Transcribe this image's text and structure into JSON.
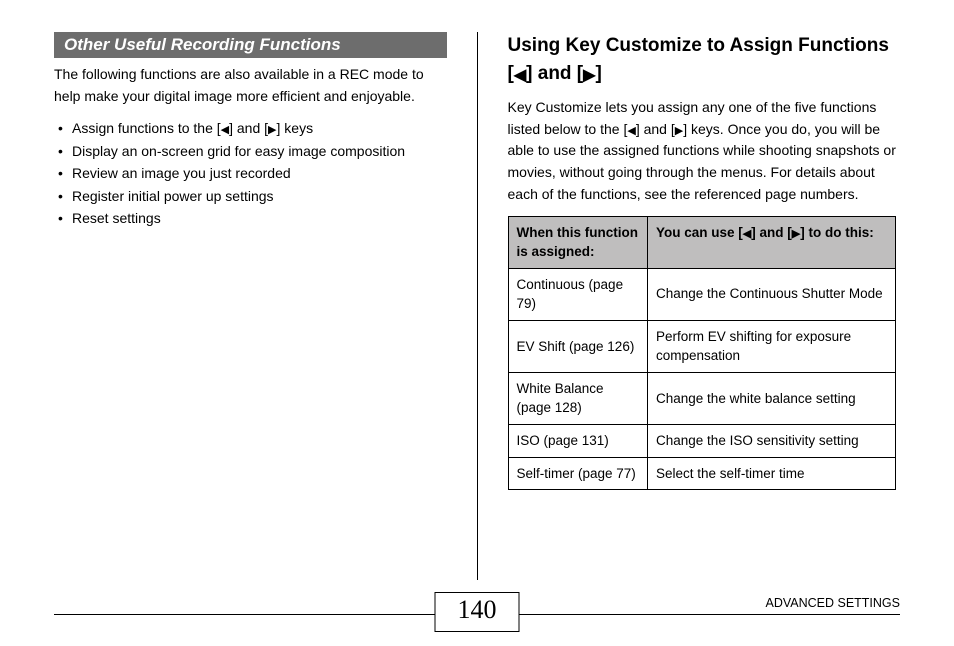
{
  "left": {
    "banner": "Other Useful Recording Functions",
    "intro": "The following functions are also available in a REC mode to help make your digital image more efficient and enjoyable.",
    "bullets": {
      "b0a": "Assign functions to the [",
      "b0b": "] and [",
      "b0c": "] keys",
      "b1": "Display an on-screen grid for easy image composition",
      "b2": "Review an image you just recorded",
      "b3": "Register initial power up settings",
      "b4": "Reset settings"
    }
  },
  "right": {
    "heading_a": "Using Key Customize to Assign Functions [",
    "heading_b": "] and [",
    "heading_c": "]",
    "intro_a": "Key Customize lets you assign any one of the five functions listed below to the [",
    "intro_b": "] and [",
    "intro_c": "] keys. Once you do, you will be able to use the assigned functions while shooting snapshots or movies, without going through the menus. For details about each of the functions, see the referenced page numbers.",
    "table": {
      "th1": "When this function is assigned:",
      "th2a": "You can use [",
      "th2b": "] and [",
      "th2c": "] to do this:",
      "rows": [
        {
          "a": "Continuous (page 79)",
          "b": "Change the Continuous Shutter Mode"
        },
        {
          "a": "EV Shift (page 126)",
          "b": "Perform EV shifting for exposure compensation"
        },
        {
          "a": "White Balance (page 128)",
          "b": "Change the white balance setting"
        },
        {
          "a": "ISO (page 131)",
          "b": "Change the ISO sensitivity setting"
        },
        {
          "a": "Self-timer (page 77)",
          "b": "Select the self-timer time"
        }
      ]
    }
  },
  "footer": {
    "page_number": "140",
    "section": "ADVANCED SETTINGS"
  }
}
